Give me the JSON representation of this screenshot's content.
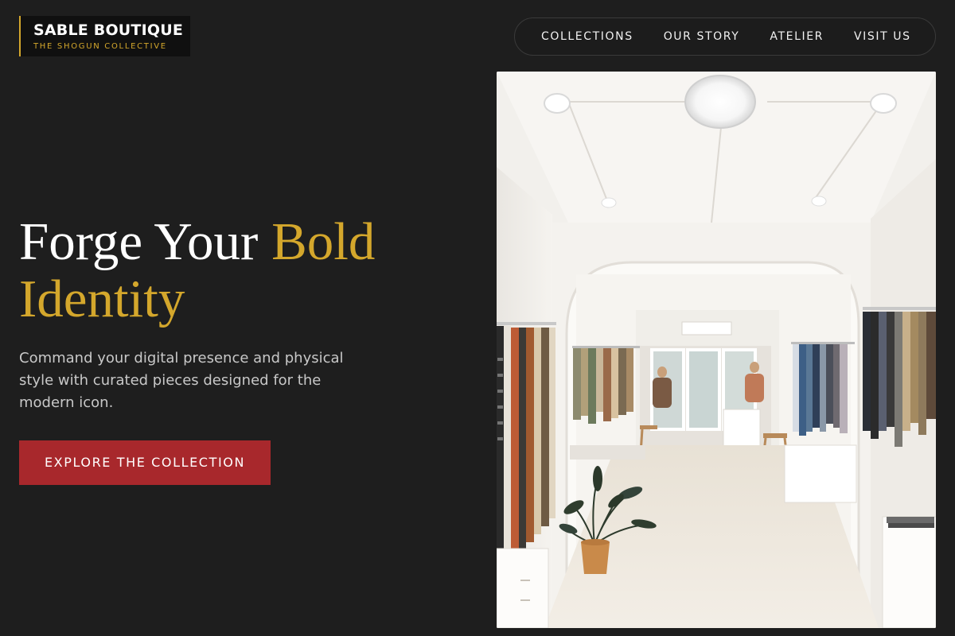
{
  "brand": {
    "name": "SABLE BOUTIQUE",
    "tagline": "THE SHOGUN COLLECTIVE",
    "accent_color": "#d4a72c"
  },
  "nav": {
    "items": [
      "COLLECTIONS",
      "OUR STORY",
      "ATELIER",
      "VISIT US"
    ]
  },
  "hero": {
    "headline_part1": "Forge Your ",
    "headline_part2": "Bold",
    "headline_part3": "Identity",
    "description": "Command your digital presence and physical style with curated pieces designed for the modern icon.",
    "cta_label": "EXPLORE THE COLLECTION",
    "cta_color": "#a8282c"
  },
  "colors": {
    "background": "#1e1e1e",
    "text": "#ffffff",
    "muted_text": "#c8c8c8"
  }
}
